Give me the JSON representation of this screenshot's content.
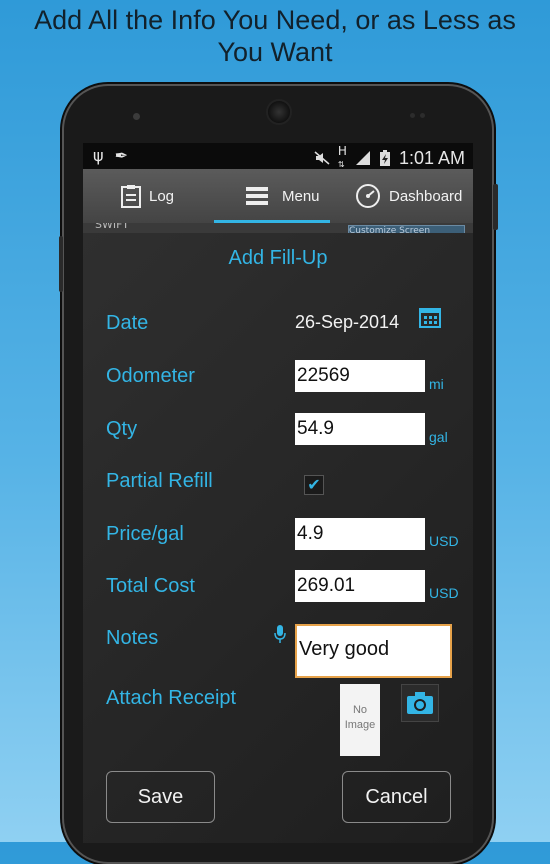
{
  "headline": {
    "line1": "Add All the Info You Need, or as Less as",
    "line2": "You Want"
  },
  "status_bar": {
    "time": "1:01 AM",
    "icons": [
      "usb-icon",
      "edit-icon",
      "mute-icon",
      "data-h-icon",
      "signal-icon",
      "battery-icon"
    ]
  },
  "tabs": [
    {
      "label": "Log",
      "icon": "clipboard-icon"
    },
    {
      "label": "Menu",
      "icon": "menu-icon",
      "selected": true
    },
    {
      "label": "Dashboard",
      "icon": "gauge-icon"
    }
  ],
  "background_peek": {
    "left_text": "SWIFT",
    "right_text": "Customize Screen"
  },
  "dialog": {
    "title": "Add Fill-Up",
    "date": {
      "label": "Date",
      "value": "26-Sep-2014"
    },
    "odometer": {
      "label": "Odometer",
      "value": "22569",
      "unit": "mi"
    },
    "qty": {
      "label": "Qty",
      "value": "54.9",
      "unit": "gal"
    },
    "partial_refill": {
      "label": "Partial Refill",
      "checked": true
    },
    "price": {
      "label": "Price/gal",
      "value": "4.9",
      "unit": "USD"
    },
    "total_cost": {
      "label": "Total Cost",
      "value": "269.01",
      "unit": "USD"
    },
    "notes": {
      "label": "Notes",
      "value": "Very good"
    },
    "attach_receipt": {
      "label": "Attach Receipt",
      "thumb_line1": "No",
      "thumb_line2": "Image"
    },
    "save_label": "Save",
    "cancel_label": "Cancel"
  },
  "colors": {
    "accent": "#33b5e5",
    "notes_border": "#e6a24a",
    "background_top": "#2f9ad8",
    "background_bottom": "#8fd0f2"
  }
}
